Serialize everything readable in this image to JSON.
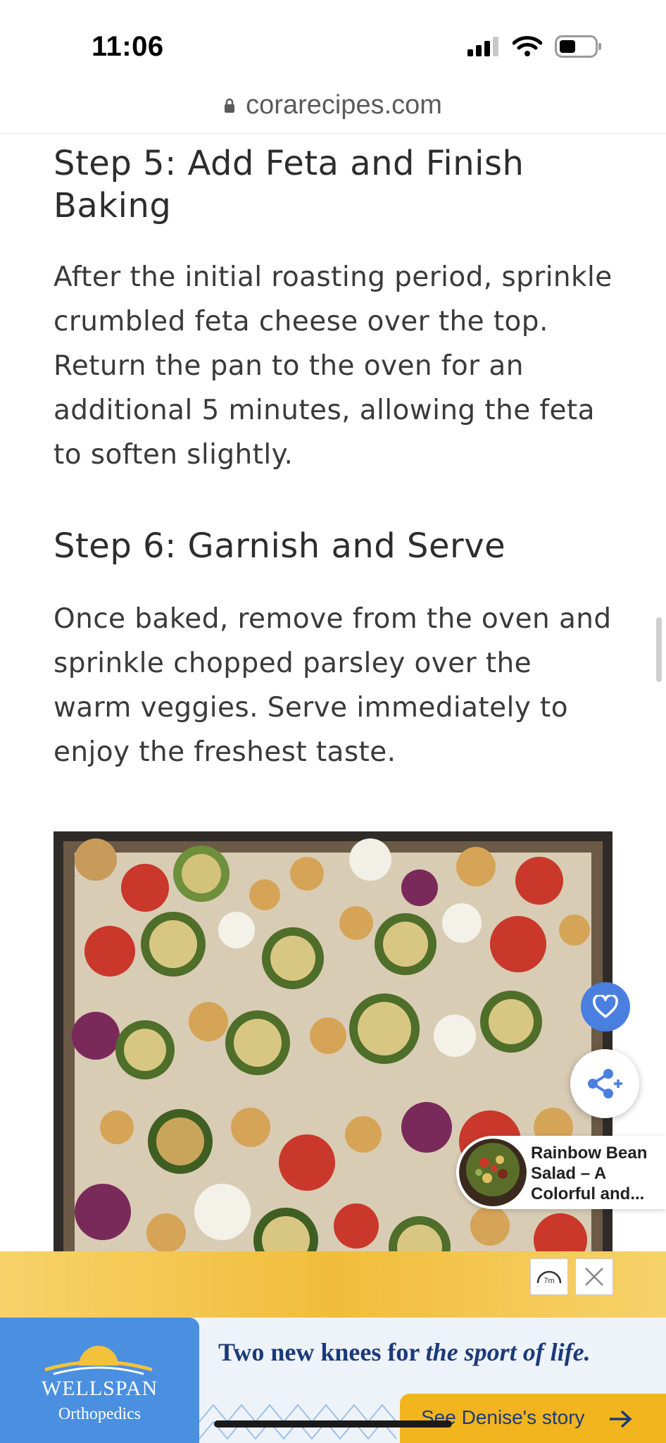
{
  "status_bar": {
    "time": "11:06"
  },
  "browser": {
    "url": "corarecipes.com"
  },
  "article": {
    "step5_title": "Step 5: Add Feta and Finish Baking",
    "step5_text": "After the initial roasting period, sprinkle crumbled feta cheese over the top. Return the pan to the oven for an additional 5 minutes, allowing the feta to soften slightly.",
    "step6_title": "Step 6: Garnish and Serve",
    "step6_text": "Once baked, remove from the oven and sprinkle chopped parsley over the warm veggies. Serve immediately to enjoy the freshest taste."
  },
  "recommendation": {
    "title": "Rainbow Bean Salad – A Colorful and..."
  },
  "ad": {
    "brand": "WELLSPAN",
    "brand_sub": "Orthopedics",
    "headline_plain": "Two new knees for ",
    "headline_italic": "the sport of life.",
    "cta": "See Denise's story"
  },
  "colors": {
    "accent_blue": "#4a7fe0",
    "ad_gold": "#f2b51e",
    "ad_navy": "#1c3a7a"
  }
}
